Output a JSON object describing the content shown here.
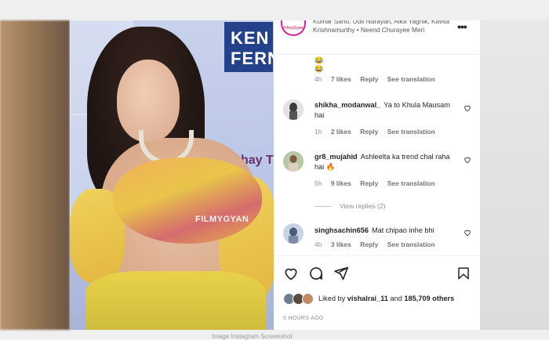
{
  "post": {
    "watermark": "FILMYGYAN",
    "brand_sign": "KEN FERN",
    "brand_sign2": "hay T",
    "audio_avatar_text": "FilmyGyan",
    "song": "Kumar Sanu, Udit Narayan, Alka Yagnik, Kavita Krishnamurthy • Neend Churayee Meri",
    "more_label": "•••"
  },
  "comments": [
    {
      "user": "",
      "text": "😂 😂",
      "age": "4h",
      "likes": "7 likes",
      "reply": "Reply",
      "translate": "See translation"
    },
    {
      "user": "shikha_modanwal_",
      "text": "Ya to Khula Mausam hai",
      "age": "1h",
      "likes": "2 likes",
      "reply": "Reply",
      "translate": "See translation"
    },
    {
      "user": "gr8_mujahid",
      "text": "Ashleelta ka trend chal raha hai 🔥",
      "age": "5h",
      "likes": "9 likes",
      "reply": "Reply",
      "translate": "See translation",
      "view_replies": "View replies (2)"
    },
    {
      "user": "singhsachin656",
      "text": "Mat chipao inhe bhi",
      "age": "4h",
      "likes": "3 likes",
      "reply": "Reply",
      "translate": "See translation"
    }
  ],
  "footer": {
    "liked_prefix": "Liked by",
    "liked_user": "vishalrai_11",
    "liked_and": "and",
    "liked_count": "185,709",
    "liked_suffix": "others",
    "date": "5 HOURS AGO",
    "below_caption": "Image Instagram Screenshot"
  },
  "colors": {
    "text": "#262626",
    "muted": "#8e8e8e",
    "ring": "#d6249f"
  },
  "icons": [
    "heart-icon",
    "comment-icon",
    "share-icon",
    "bookmark-icon",
    "more-icon"
  ]
}
